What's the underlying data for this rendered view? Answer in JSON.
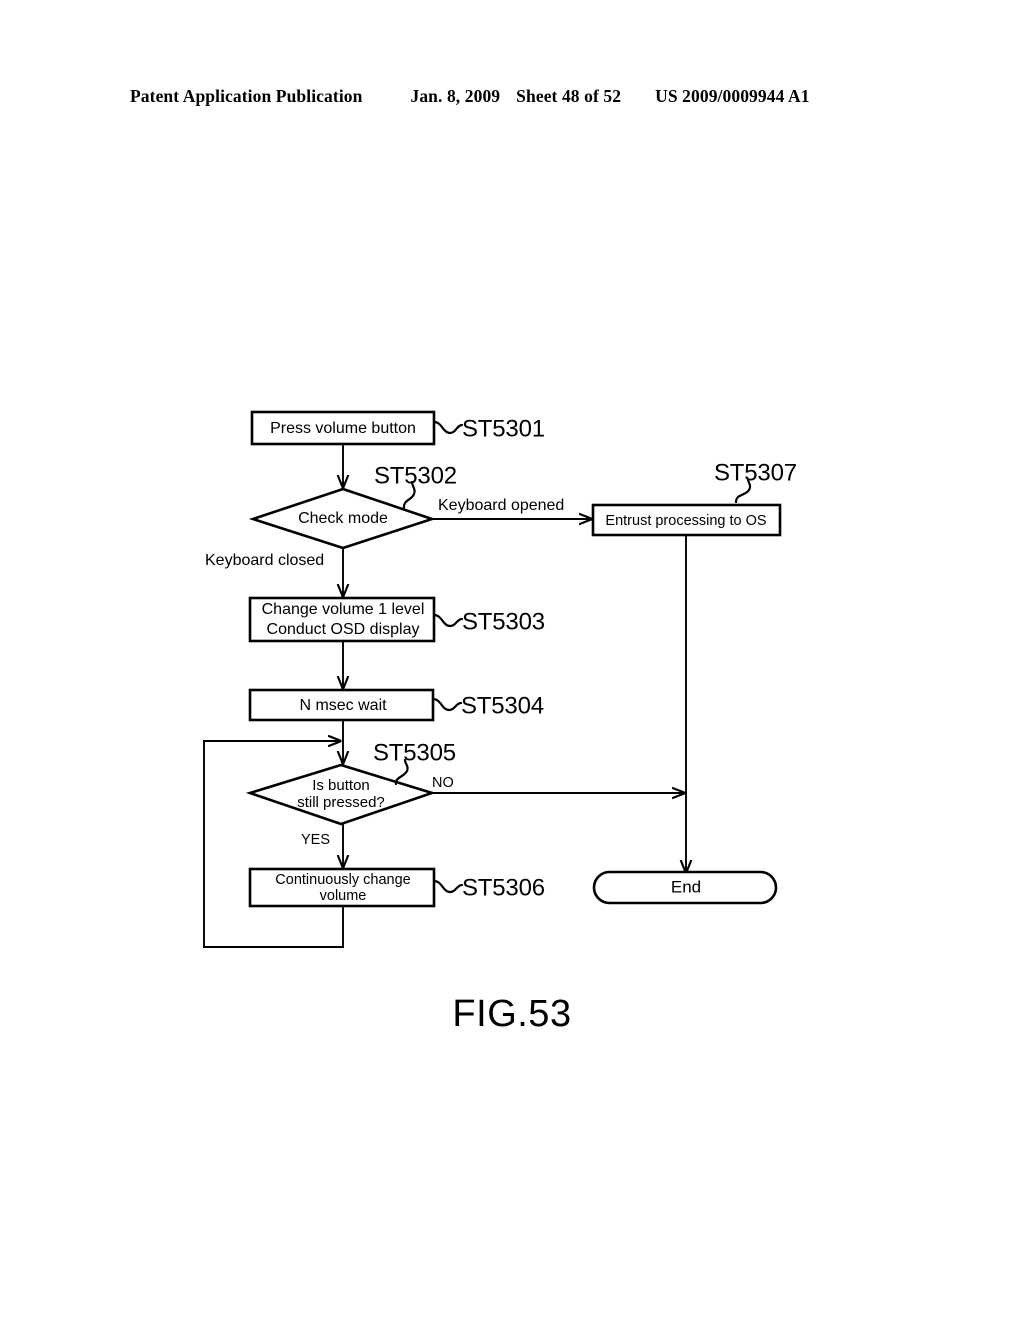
{
  "header": {
    "publication": "Patent Application Publication",
    "date": "Jan. 8, 2009",
    "sheet": "Sheet 48 of 52",
    "patent_number": "US 2009/0009944 A1"
  },
  "figure": {
    "caption": "FIG.53"
  },
  "flowchart": {
    "nodes": {
      "press_volume_button": {
        "label": "Press volume button",
        "ref": "ST5301",
        "shape": "process"
      },
      "check_mode": {
        "label": "Check mode",
        "ref": "ST5302",
        "shape": "decision"
      },
      "entrust_processing": {
        "label": "Entrust processing to OS",
        "ref": "ST5307",
        "shape": "process"
      },
      "change_volume": {
        "label_line1": "Change volume 1 level",
        "label_line2": "Conduct OSD display",
        "ref": "ST5303",
        "shape": "process"
      },
      "msec_wait": {
        "label": "N msec wait",
        "ref": "ST5304",
        "shape": "process"
      },
      "is_button_pressed": {
        "label_line1": "Is button",
        "label_line2": "still pressed?",
        "ref": "ST5305",
        "shape": "decision"
      },
      "continuously_change_volume": {
        "label_line1": "Continuously change",
        "label_line2": "volume",
        "ref": "ST5306",
        "shape": "process"
      },
      "end": {
        "label": "End",
        "shape": "terminator"
      }
    },
    "edge_labels": {
      "keyboard_opened": "Keyboard opened",
      "keyboard_closed": "Keyboard closed",
      "no": "NO",
      "yes": "YES"
    }
  },
  "colors": {
    "ink": "#000000",
    "paper": "#ffffff"
  }
}
